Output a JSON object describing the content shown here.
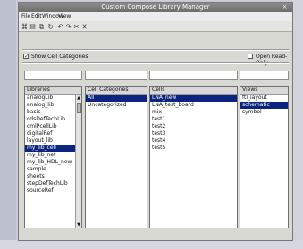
{
  "window": {
    "title": "Custom Compose Library Manager",
    "sys_button": "×"
  },
  "menubar": [
    "File",
    "Edit",
    "Window",
    "View"
  ],
  "toolbar": {
    "icons": [
      "tool-icon",
      "save-icon",
      "copy-icon",
      "refresh-icon",
      "undo-icon",
      "redo-icon",
      "cut-icon",
      "delete-icon"
    ],
    "glyphs": [
      "⌘",
      "▤",
      "⧉",
      "↻",
      "↶",
      "↷",
      "✂",
      "✕"
    ]
  },
  "options": {
    "show_categories_label": "Show Cell Categories",
    "show_categories_checked": "✓",
    "open_read_only_label": "Open Read-Only",
    "open_read_only_checked": ""
  },
  "lists": {
    "libraries": {
      "header": "Libraries",
      "items": [
        "analogLib",
        "analog_lib",
        "basic",
        "cdsDefTechLib",
        "cmlPcellLib",
        "digitalRef",
        "layout_lib",
        "my_lib_cell",
        "my_lib_net",
        "my_lib_HDL_new",
        "sample",
        "sheets",
        "stepDefTechLib",
        "sourceRef"
      ],
      "selected_index": 7,
      "scroll_up": "▲",
      "scroll_down": "▼"
    },
    "categories": {
      "header": "Cell Categories",
      "items": [
        "All",
        "Uncategorized"
      ],
      "selected_index": 0
    },
    "cells": {
      "header": "Cells",
      "items": [
        "LNA_new",
        "LNA_test_board",
        "mix",
        "test1",
        "test2",
        "test3",
        "test4",
        "test5"
      ],
      "selected_index": 0
    },
    "views": {
      "header": "Views",
      "items": [
        "ftl_layout",
        "schematic",
        "symbol"
      ],
      "selected_index": 1
    }
  }
}
